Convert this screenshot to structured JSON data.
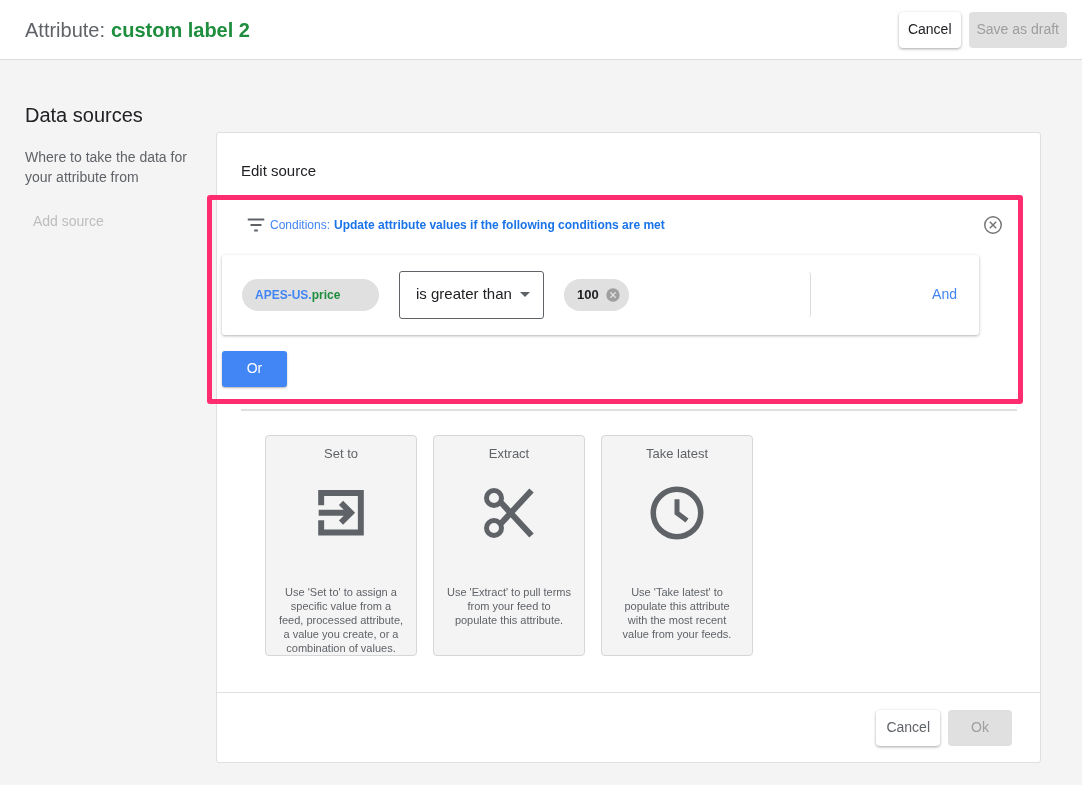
{
  "header": {
    "title_prefix": "Attribute:",
    "title_name": "custom label 2",
    "buttons": [
      {
        "label": "Cancel",
        "disabled": false
      },
      {
        "label": "Save as draft",
        "disabled": true
      }
    ]
  },
  "sidebar": {
    "heading": "Data sources",
    "description": "Where to take the data for your attribute from",
    "add_source": "Add source"
  },
  "editor": {
    "title": "Edit source",
    "conditions": {
      "label": "Conditions:",
      "description": "Update attribute values if the following conditions are met",
      "highlighted": true,
      "rules": [
        {
          "field_source": "APES-US.",
          "field_name": "price",
          "operator": "is greater than",
          "values": [
            "100"
          ],
          "and_label": "And"
        }
      ],
      "or_label": "Or"
    },
    "actions": [
      {
        "kind": "set",
        "title": "Set to",
        "description": "Use 'Set to' to assign a specific value from a feed, processed attribute, a value you create, or a combination of values."
      },
      {
        "kind": "extract",
        "title": "Extract",
        "description": "Use 'Extract' to pull terms from your feed to populate this attribute."
      },
      {
        "kind": "latest",
        "title": "Take latest",
        "description": "Use 'Take latest' to populate this attribute with the most recent value from your feeds."
      }
    ],
    "buttons": [
      {
        "label": "Cancel",
        "disabled": false
      },
      {
        "label": "Ok",
        "disabled": true
      }
    ]
  }
}
